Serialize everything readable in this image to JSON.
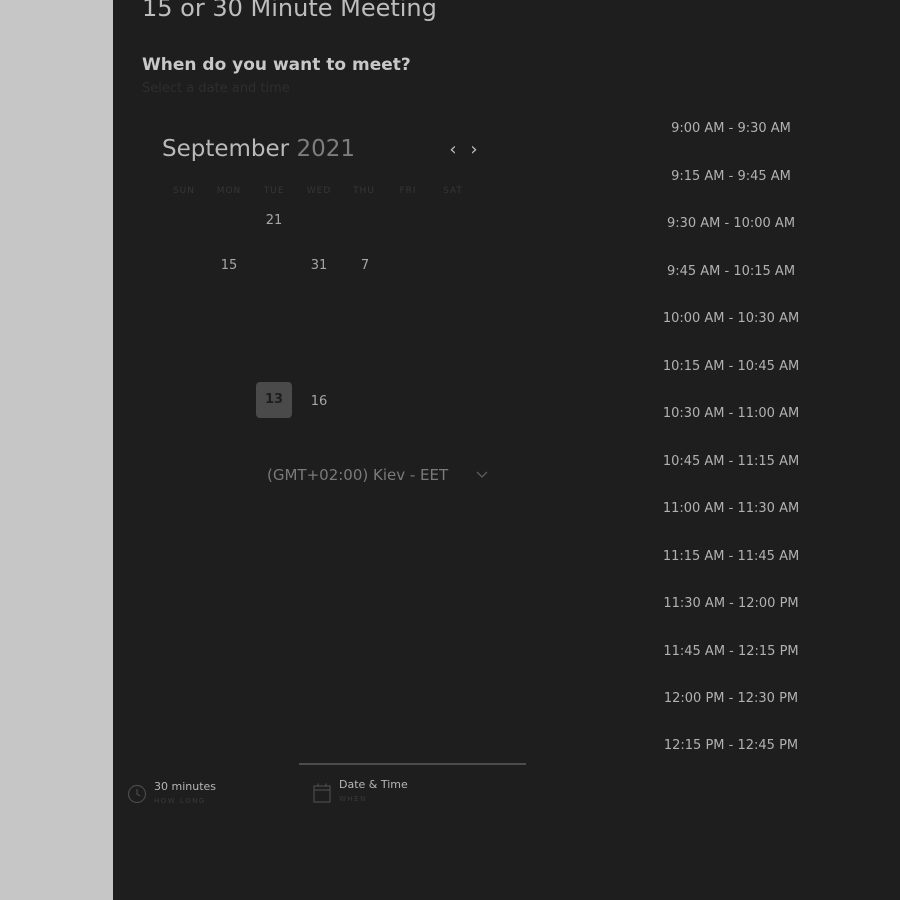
{
  "header": {
    "title": "15 or 30 Minute Meeting",
    "subtitle": "When do you want to meet?",
    "hint": "Select a date and time"
  },
  "calendar": {
    "month": "September",
    "year": "2021",
    "prev_icon": "chevron-left-icon",
    "next_icon": "chevron-right-icon",
    "weekdays": [
      "SUN",
      "MON",
      "TUE",
      "WED",
      "THU",
      "FRI",
      "SAT"
    ],
    "visible_days": [
      "21",
      "15",
      "31",
      "7",
      "13",
      "16"
    ],
    "selected_day": "13"
  },
  "timezone": {
    "label": "(GMT+02:00) Kiev - EET",
    "chevron_icon": "chevron-down-icon"
  },
  "time_slots": [
    "9:00 AM - 9:30 AM",
    "9:15 AM - 9:45 AM",
    "9:30 AM - 10:00 AM",
    "9:45 AM - 10:15 AM",
    "10:00 AM - 10:30 AM",
    "10:15 AM - 10:45 AM",
    "10:30 AM - 11:00 AM",
    "10:45 AM - 11:15 AM",
    "11:00 AM - 11:30 AM",
    "11:15 AM - 11:45 AM",
    "11:30 AM - 12:00 PM",
    "11:45 AM - 12:15 PM",
    "12:00 PM - 12:30 PM",
    "12:15 PM - 12:45 PM"
  ],
  "steps": [
    {
      "label": "30 minutes",
      "sub": "HOW LONG",
      "icon": "clock-icon"
    },
    {
      "label": "Date & Time",
      "sub": "WHEN",
      "icon": "calendar-icon"
    }
  ]
}
